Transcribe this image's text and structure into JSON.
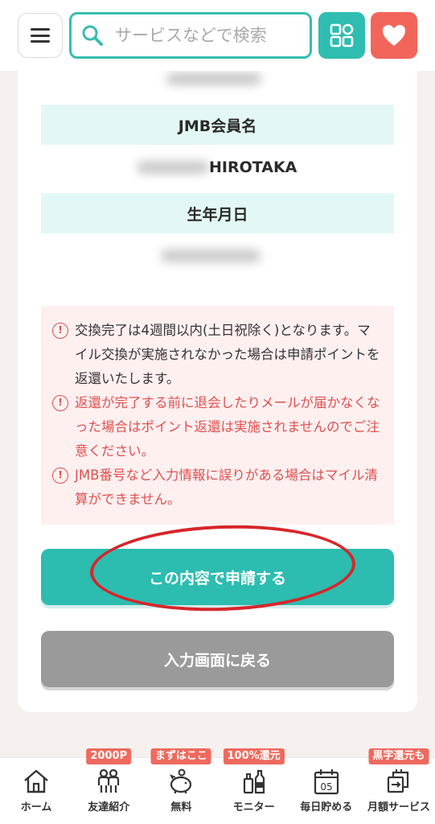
{
  "header": {
    "search_placeholder": "サービスなどで検索"
  },
  "form": {
    "jmb_member_name_label": "JMB会員名",
    "jmb_member_name_value": "HIROTAKA",
    "birthday_label": "生年月日"
  },
  "notices": [
    {
      "text": "交換完了は4週間以内(土日祝除く)となります。マイル交換が実施されなかった場合は申請ポイントを返還いたします。",
      "tone": "dark"
    },
    {
      "text": "返還が完了する前に退会したりメールが届かなくなった場合はポイント返還は実施されませんのでご注意ください。",
      "tone": "red"
    },
    {
      "text": "JMB番号など入力情報に誤りがある場合はマイル清算ができません。",
      "tone": "red"
    }
  ],
  "buttons": {
    "submit_label": "この内容で申請する",
    "back_label": "入力画面に戻る"
  },
  "bottom_nav": {
    "items": [
      {
        "label": "ホーム",
        "icon": "home-icon",
        "badge": ""
      },
      {
        "label": "友達紹介",
        "icon": "friends-icon",
        "badge": "2000P"
      },
      {
        "label": "無料",
        "icon": "piggy-bank-icon",
        "badge": "まずはここ"
      },
      {
        "label": "モニター",
        "icon": "bottles-icon",
        "badge": "100%還元"
      },
      {
        "label": "毎日貯める",
        "icon": "calendar-icon",
        "badge": "",
        "calendar_day": "05"
      },
      {
        "label": "月額サービス",
        "icon": "subscription-icon",
        "badge": "黒字還元も"
      }
    ]
  },
  "colors": {
    "accent_teal": "#2cbcb0",
    "heart_red": "#f2655a",
    "warning_red": "#e04f4f",
    "annotation_red": "#d7262a"
  }
}
